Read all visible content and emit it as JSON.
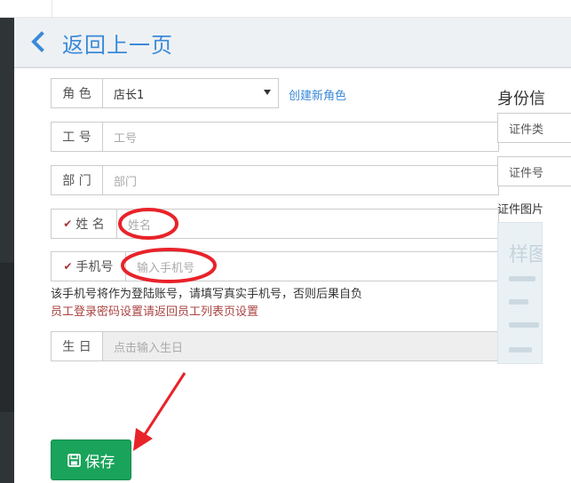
{
  "header": {
    "back_title": "返回上一页"
  },
  "form": {
    "role": {
      "label": "角 色",
      "value": "店长1",
      "create_link": "创建新角色"
    },
    "employee_no": {
      "label": "工 号",
      "placeholder": "工号"
    },
    "department": {
      "label": "部 门",
      "placeholder": "部门"
    },
    "name": {
      "label": "姓 名",
      "placeholder": "姓名"
    },
    "phone": {
      "label": "手机号",
      "placeholder": "输入手机号"
    },
    "phone_note": "该手机号将作为登陆账号，请填写真实手机号，否则后果自负",
    "password_note": "员工登录密码设置请返回员工列表页设置",
    "birthday": {
      "label": "生 日",
      "placeholder": "点击输入生日"
    },
    "save_label": "保存"
  },
  "identity": {
    "title": "身份信",
    "id_type_partial": "证件类",
    "id_number_partial": "证件号",
    "id_image_label": "证件图片",
    "sample_watermark": "样图"
  },
  "colors": {
    "accent": "#3a8ad8",
    "save_green": "#1aa35a",
    "warning_red": "#a94442",
    "annotation_red": "#e8232a"
  }
}
